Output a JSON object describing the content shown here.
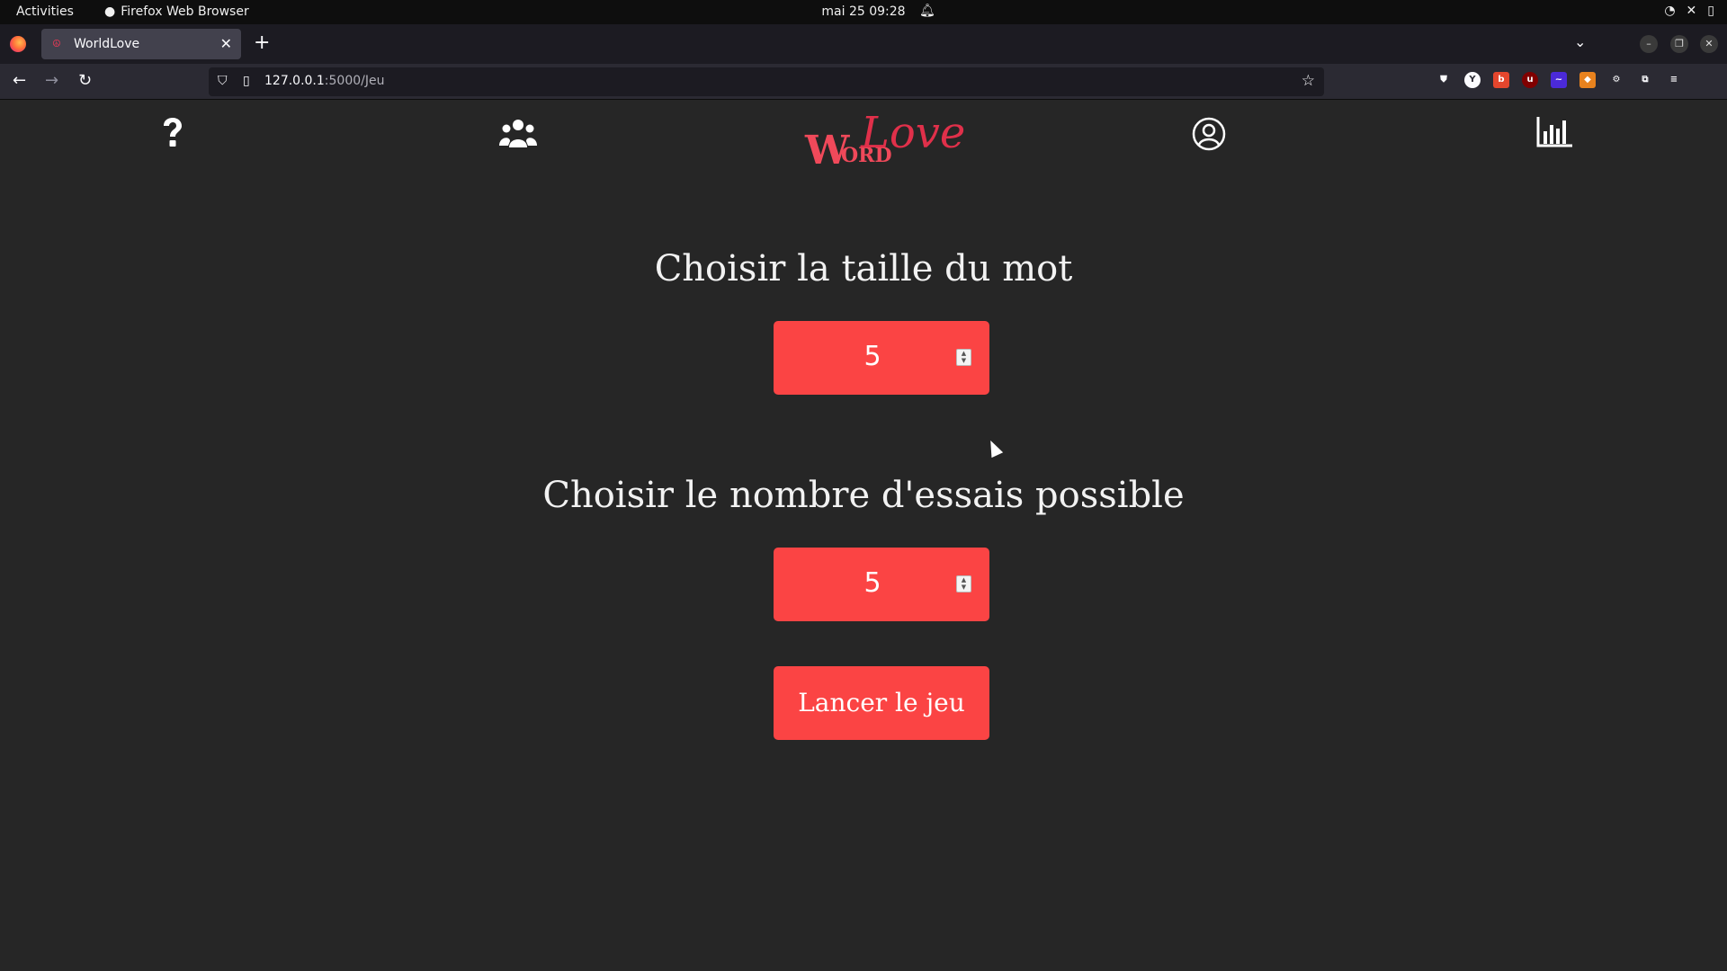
{
  "system_bar": {
    "activities": "Activities",
    "app_name": "Firefox Web Browser",
    "clock": "mai 25  09:28"
  },
  "browser": {
    "tab_title": "WorldLove",
    "url_host": "127.0.0.1",
    "url_path": ":5000/Jeu"
  },
  "site": {
    "logo_w": "W",
    "logo_ord": "ORD",
    "logo_love": "Love",
    "nav_icons": [
      "help-icon",
      "users-icon",
      "account-icon",
      "stats-icon"
    ]
  },
  "form": {
    "word_size_label": "Choisir la taille du mot",
    "word_size_value": "5",
    "tries_label": "Choisir le nombre d'essais possible",
    "tries_value": "5",
    "launch_label": "Lancer le jeu"
  },
  "colors": {
    "accent": "#fb4444",
    "background": "#262626"
  }
}
